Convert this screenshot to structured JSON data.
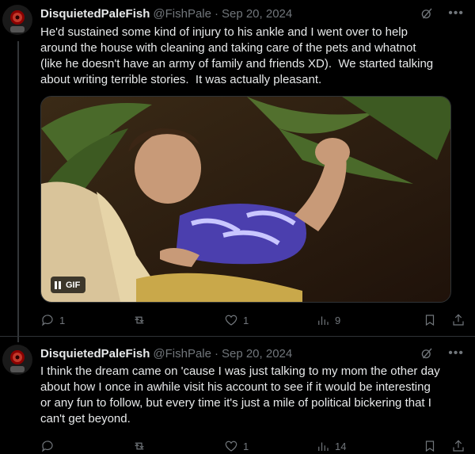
{
  "tweets": [
    {
      "author_name": "DisquietedPaleFish",
      "handle": "@FishPale",
      "separator": "·",
      "date": "Sep 20, 2024",
      "text": "He'd sustained some kind of injury to his ankle and I went over to help\naround the house with cleaning and taking care of the pets and whatnot\n(like he doesn't have an army of family and friends XD).  We started talking\nabout writing terrible stories.  It was actually pleasant.",
      "media": {
        "badge": "GIF"
      },
      "stats": {
        "replies": "1",
        "retweets": "",
        "likes": "1",
        "views": "9"
      }
    },
    {
      "author_name": "DisquietedPaleFish",
      "handle": "@FishPale",
      "separator": "·",
      "date": "Sep 20, 2024",
      "text": "I think the dream came on 'cause I was just talking to my mom the other day\nabout how I once in awhile visit his account to see if it would be interesting\nor any fun to follow, but every time it's just a mile of political bickering that I\ncan't get beyond.",
      "stats": {
        "replies": "",
        "retweets": "",
        "likes": "1",
        "views": "14"
      }
    }
  ],
  "icons": {
    "more": "more-icon",
    "grok": "grok-icon",
    "reply": "reply-icon",
    "retweet": "retweet-icon",
    "like": "heart-icon",
    "views": "views-icon",
    "bookmark": "bookmark-icon",
    "share": "share-icon"
  },
  "colors": {
    "background": "#000000",
    "text": "#e7e9ea",
    "muted": "#71767b",
    "divider": "#2f3336"
  }
}
